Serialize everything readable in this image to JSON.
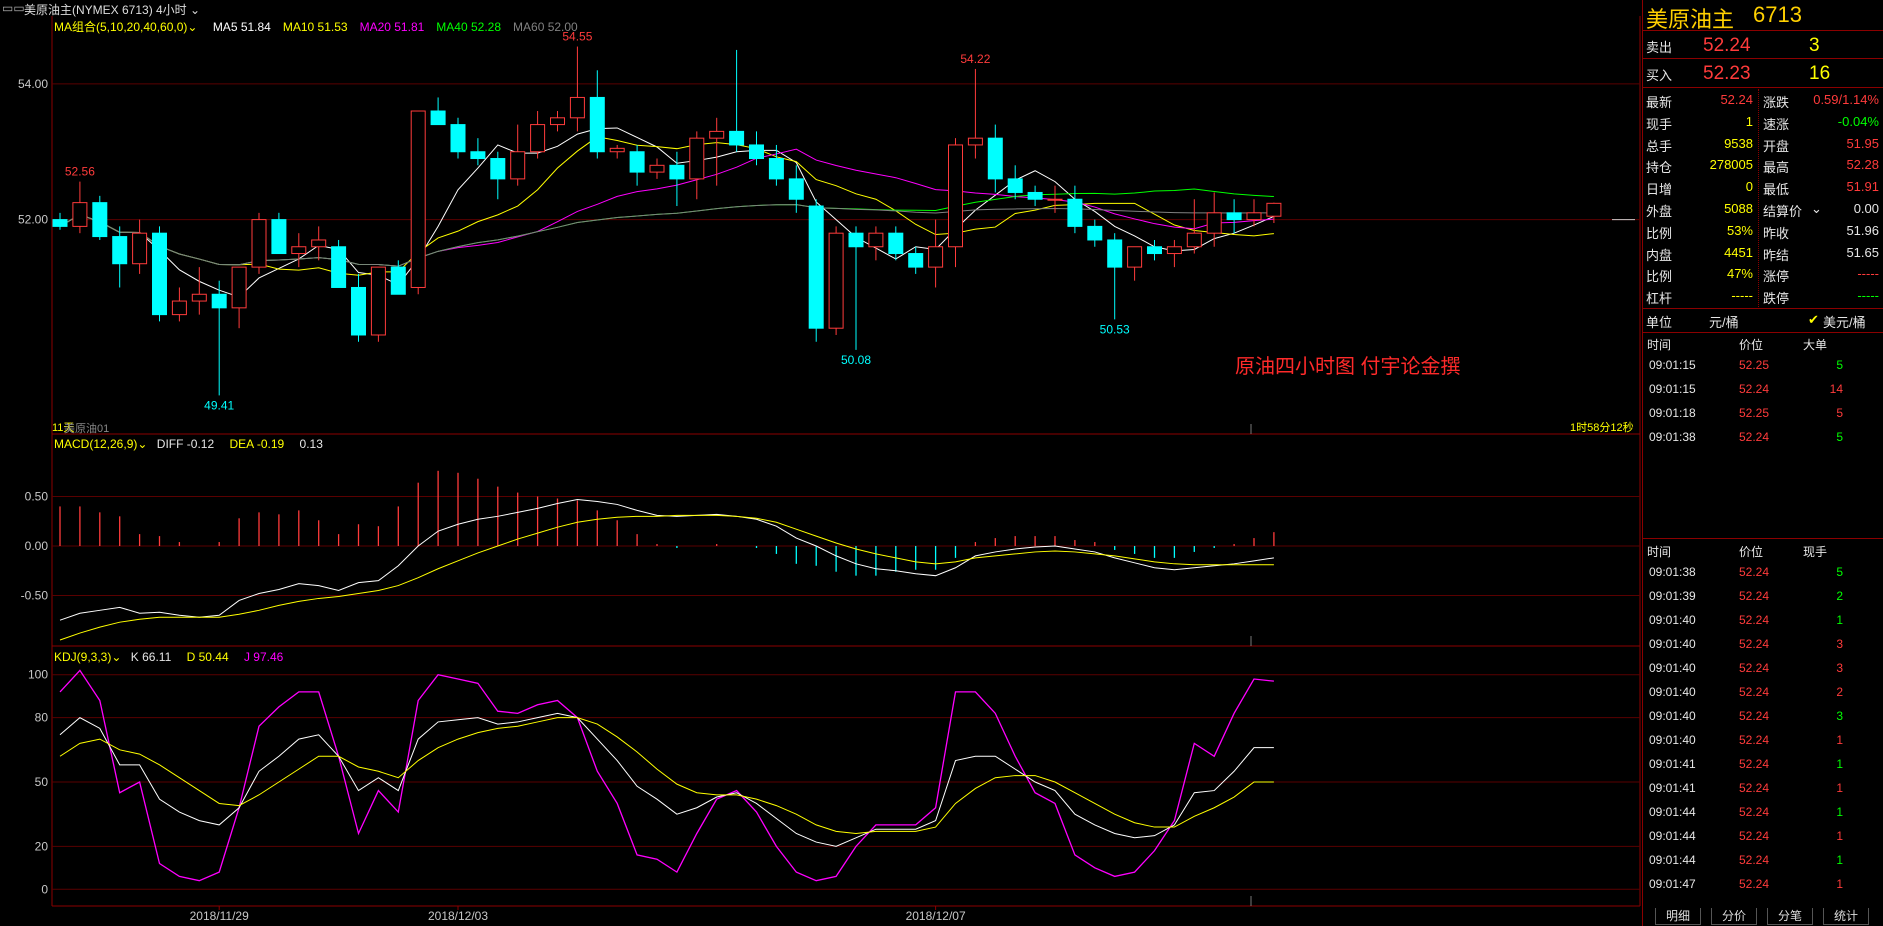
{
  "title_bar": {
    "symbol": "美原油主(NYMEX 6713)",
    "period": "4小时"
  },
  "chart_data": [
    {
      "type": "candlestick",
      "title": "MA组合(5,10,20,40,60,0)",
      "ma_labels": [
        {
          "name": "MA5",
          "value": "51.84",
          "color": "#ffffff"
        },
        {
          "name": "MA10",
          "value": "51.53",
          "color": "#ffff00"
        },
        {
          "name": "MA20",
          "value": "51.81",
          "color": "#ff00ff"
        },
        {
          "name": "MA40",
          "value": "52.28",
          "color": "#00ff00"
        },
        {
          "name": "MA60",
          "value": "52.00",
          "color": "#808080"
        }
      ],
      "ylim": [
        48.9,
        55.0
      ],
      "y_ticks": [
        "54.00",
        "52.00"
      ],
      "x_ticks": [
        {
          "label": "2018/11/29",
          "index": 8
        },
        {
          "label": "2018/12/03",
          "index": 20
        },
        {
          "label": "2018/12/07",
          "index": 44
        }
      ],
      "annotations": [
        {
          "text": "52.56",
          "index": 1,
          "price": 52.56,
          "color": "#ff3b3b",
          "pos": "above"
        },
        {
          "text": "49.41",
          "index": 8,
          "price": 49.41,
          "color": "#00ffff",
          "pos": "below"
        },
        {
          "text": "54.55",
          "index": 26,
          "price": 54.55,
          "color": "#ff3b3b",
          "pos": "above"
        },
        {
          "text": "54.22",
          "index": 46,
          "price": 54.22,
          "color": "#ff3b3b",
          "pos": "above"
        },
        {
          "text": "50.08",
          "index": 40,
          "price": 50.08,
          "color": "#00ffff",
          "pos": "below"
        },
        {
          "text": "50.53",
          "index": 53,
          "price": 50.53,
          "color": "#00ffff",
          "pos": "below"
        }
      ],
      "candles": [
        [
          52.0,
          52.1,
          51.85,
          51.9
        ],
        [
          51.9,
          52.56,
          51.8,
          52.25
        ],
        [
          52.25,
          52.35,
          51.7,
          51.75
        ],
        [
          51.75,
          51.9,
          51.0,
          51.35
        ],
        [
          51.35,
          52.0,
          51.2,
          51.8
        ],
        [
          51.8,
          51.9,
          50.5,
          50.6
        ],
        [
          50.6,
          51.0,
          50.5,
          50.8
        ],
        [
          50.8,
          51.3,
          50.6,
          50.9
        ],
        [
          50.9,
          51.1,
          49.41,
          50.7
        ],
        [
          50.7,
          51.3,
          50.4,
          51.3
        ],
        [
          51.3,
          52.1,
          51.2,
          52.0
        ],
        [
          52.0,
          52.1,
          51.5,
          51.5
        ],
        [
          51.5,
          51.8,
          51.3,
          51.6
        ],
        [
          51.6,
          51.9,
          51.4,
          51.7
        ],
        [
          51.6,
          51.7,
          51.0,
          51.0
        ],
        [
          51.0,
          51.2,
          50.2,
          50.3
        ],
        [
          50.3,
          51.3,
          50.2,
          51.3
        ],
        [
          51.3,
          51.4,
          50.9,
          50.9
        ],
        [
          51.0,
          53.6,
          50.9,
          53.6
        ],
        [
          53.6,
          53.8,
          53.4,
          53.4
        ],
        [
          53.4,
          53.5,
          52.9,
          53.0
        ],
        [
          53.0,
          53.2,
          52.8,
          52.9
        ],
        [
          52.9,
          53.0,
          52.3,
          52.6
        ],
        [
          52.6,
          53.4,
          52.5,
          53.0
        ],
        [
          53.0,
          53.6,
          52.9,
          53.4
        ],
        [
          53.4,
          53.6,
          53.3,
          53.5
        ],
        [
          53.5,
          54.55,
          53.3,
          53.8
        ],
        [
          53.8,
          54.2,
          52.9,
          53.0
        ],
        [
          53.0,
          53.1,
          52.9,
          53.05
        ],
        [
          53.0,
          53.1,
          52.5,
          52.7
        ],
        [
          52.7,
          52.9,
          52.6,
          52.8
        ],
        [
          52.8,
          53.0,
          52.2,
          52.6
        ],
        [
          52.6,
          53.3,
          52.3,
          53.2
        ],
        [
          53.2,
          53.5,
          52.5,
          53.3
        ],
        [
          53.3,
          54.5,
          53.0,
          53.1
        ],
        [
          53.1,
          53.3,
          52.8,
          52.9
        ],
        [
          52.9,
          53.1,
          52.5,
          52.6
        ],
        [
          52.6,
          52.8,
          52.1,
          52.3
        ],
        [
          52.2,
          52.3,
          50.2,
          50.4
        ],
        [
          50.4,
          51.9,
          50.3,
          51.8
        ],
        [
          51.8,
          51.9,
          50.08,
          51.6
        ],
        [
          51.6,
          51.9,
          51.4,
          51.8
        ],
        [
          51.8,
          51.9,
          51.4,
          51.5
        ],
        [
          51.5,
          51.6,
          51.2,
          51.3
        ],
        [
          51.3,
          52.0,
          51.0,
          51.6
        ],
        [
          51.6,
          53.2,
          51.3,
          53.1
        ],
        [
          53.1,
          54.22,
          52.9,
          53.2
        ],
        [
          53.2,
          53.4,
          52.4,
          52.6
        ],
        [
          52.6,
          52.8,
          52.3,
          52.4
        ],
        [
          52.4,
          52.5,
          52.2,
          52.3
        ],
        [
          52.3,
          52.5,
          52.1,
          52.3
        ],
        [
          52.3,
          52.5,
          51.8,
          51.9
        ],
        [
          51.9,
          52.0,
          51.6,
          51.7
        ],
        [
          51.7,
          51.8,
          50.53,
          51.3
        ],
        [
          51.3,
          51.6,
          51.1,
          51.6
        ],
        [
          51.6,
          51.7,
          51.4,
          51.5
        ],
        [
          51.5,
          51.7,
          51.3,
          51.6
        ],
        [
          51.6,
          52.3,
          51.5,
          51.8
        ],
        [
          51.8,
          52.4,
          51.6,
          52.1
        ],
        [
          52.1,
          52.3,
          51.8,
          52.0
        ],
        [
          52.0,
          52.3,
          51.9,
          52.1
        ],
        [
          52.05,
          52.25,
          51.95,
          52.24
        ]
      ],
      "watermark": "原油四小时图  付宇论金撰",
      "bottom_left_label": "11天",
      "bottom_left_label2": "美原油01",
      "countdown": "1时58分12秒"
    },
    {
      "type": "macd",
      "title": "MACD(12,26,9)",
      "diff_label": "DIFF -0.12",
      "dea_label": "DEA -0.19",
      "macd_label": "0.13",
      "ylim": [
        -0.95,
        0.95
      ],
      "y_ticks": [
        "0.50",
        "0.00",
        "-0.50"
      ],
      "diff": [
        -0.75,
        -0.68,
        -0.65,
        -0.62,
        -0.68,
        -0.67,
        -0.7,
        -0.72,
        -0.7,
        -0.55,
        -0.48,
        -0.44,
        -0.38,
        -0.4,
        -0.45,
        -0.37,
        -0.35,
        -0.2,
        0.0,
        0.15,
        0.22,
        0.27,
        0.3,
        0.34,
        0.38,
        0.43,
        0.47,
        0.45,
        0.42,
        0.36,
        0.31,
        0.3,
        0.31,
        0.32,
        0.3,
        0.27,
        0.2,
        0.08,
        0.0,
        -0.1,
        -0.18,
        -0.23,
        -0.25,
        -0.28,
        -0.3,
        -0.22,
        -0.1,
        -0.06,
        -0.03,
        -0.01,
        0.0,
        -0.03,
        -0.06,
        -0.12,
        -0.17,
        -0.22,
        -0.24,
        -0.22,
        -0.2,
        -0.18,
        -0.15,
        -0.12
      ],
      "dea": [
        -0.95,
        -0.88,
        -0.82,
        -0.77,
        -0.74,
        -0.72,
        -0.72,
        -0.72,
        -0.72,
        -0.69,
        -0.65,
        -0.6,
        -0.56,
        -0.53,
        -0.51,
        -0.48,
        -0.45,
        -0.4,
        -0.32,
        -0.23,
        -0.15,
        -0.07,
        0.0,
        0.07,
        0.13,
        0.19,
        0.24,
        0.27,
        0.29,
        0.3,
        0.3,
        0.31,
        0.31,
        0.31,
        0.3,
        0.28,
        0.24,
        0.17,
        0.1,
        0.03,
        -0.03,
        -0.08,
        -0.12,
        -0.16,
        -0.18,
        -0.16,
        -0.12,
        -0.1,
        -0.08,
        -0.06,
        -0.05,
        -0.06,
        -0.08,
        -0.1,
        -0.13,
        -0.16,
        -0.18,
        -0.19,
        -0.19,
        -0.19,
        -0.19,
        -0.19
      ]
    },
    {
      "type": "kdj",
      "title": "KDJ(9,3,3)",
      "k_label": "K 66.11",
      "d_label": "D 50.44",
      "j_label": "J 97.46",
      "ylim": [
        -5,
        105
      ],
      "y_ticks": [
        "100",
        "80",
        "50",
        "20",
        "0"
      ],
      "k": [
        72,
        80,
        75,
        58,
        58,
        42,
        36,
        32,
        30,
        38,
        55,
        62,
        70,
        72,
        62,
        46,
        52,
        46,
        70,
        78,
        79,
        80,
        77,
        78,
        80,
        82,
        80,
        70,
        60,
        48,
        42,
        35,
        38,
        43,
        45,
        40,
        33,
        26,
        22,
        20,
        24,
        28,
        28,
        28,
        32,
        60,
        62,
        62,
        56,
        50,
        46,
        35,
        30,
        26,
        24,
        25,
        30,
        45,
        46,
        55,
        66,
        66
      ],
      "d": [
        62,
        68,
        70,
        65,
        63,
        58,
        52,
        46,
        40,
        39,
        44,
        50,
        56,
        62,
        62,
        57,
        55,
        52,
        60,
        66,
        70,
        73,
        75,
        76,
        78,
        80,
        80,
        77,
        71,
        64,
        56,
        49,
        45,
        44,
        44,
        42,
        39,
        35,
        30,
        27,
        26,
        27,
        27,
        27,
        29,
        40,
        47,
        52,
        53,
        53,
        50,
        45,
        40,
        35,
        31,
        29,
        29,
        34,
        38,
        43,
        50,
        50
      ],
      "j": [
        92,
        102,
        88,
        45,
        50,
        12,
        6,
        4,
        8,
        38,
        76,
        85,
        92,
        92,
        62,
        26,
        46,
        36,
        88,
        100,
        98,
        96,
        83,
        82,
        86,
        88,
        80,
        55,
        40,
        16,
        14,
        8,
        26,
        42,
        46,
        36,
        20,
        8,
        4,
        6,
        20,
        30,
        30,
        30,
        38,
        92,
        92,
        82,
        62,
        45,
        40,
        16,
        10,
        6,
        8,
        18,
        32,
        68,
        62,
        82,
        98,
        97
      ]
    }
  ],
  "right_panel": {
    "title": "美原油主",
    "code": "6713",
    "ask": {
      "label": "卖出",
      "price": "52.24",
      "vol": "3"
    },
    "bid": {
      "label": "买入",
      "price": "52.23",
      "vol": "16"
    },
    "stats_left": [
      {
        "label": "最新",
        "value": "52.24",
        "color": "red"
      },
      {
        "label": "现手",
        "value": "1",
        "color": "yel"
      },
      {
        "label": "总手",
        "value": "9538",
        "color": "yel"
      },
      {
        "label": "持仓",
        "value": "278005",
        "color": "yel"
      },
      {
        "label": "日增",
        "value": "0",
        "color": "yel"
      },
      {
        "label": "外盘",
        "value": "5088",
        "color": "yel"
      },
      {
        "label": "比例",
        "value": "53%",
        "color": "yel"
      },
      {
        "label": "内盘",
        "value": "4451",
        "color": "yel"
      },
      {
        "label": "比例",
        "value": "47%",
        "color": "yel"
      },
      {
        "label": "杠杆",
        "value": "-----",
        "color": "yel"
      }
    ],
    "stats_right": [
      {
        "label": "涨跌",
        "value": "0.59/1.14%",
        "color": "red"
      },
      {
        "label": "速涨",
        "value": "-0.04%",
        "color": "grn"
      },
      {
        "label": "开盘",
        "value": "51.95",
        "color": "red"
      },
      {
        "label": "最高",
        "value": "52.28",
        "color": "red"
      },
      {
        "label": "最低",
        "value": "51.91",
        "color": "red"
      },
      {
        "label": "结算价",
        "value": "0.00",
        "color": "wht"
      },
      {
        "label": "昨收",
        "value": "51.96",
        "color": "wht"
      },
      {
        "label": "昨结",
        "value": "51.65",
        "color": "wht"
      },
      {
        "label": "涨停",
        "value": "-----",
        "color": "red"
      },
      {
        "label": "跌停",
        "value": "-----",
        "color": "grn"
      }
    ],
    "unit": {
      "label": "单位",
      "opt1": "元/桶",
      "opt2": "美元/桶"
    },
    "big_orders": {
      "headers": [
        "时间",
        "价位",
        "大单"
      ],
      "rows": [
        {
          "t": "09:01:15",
          "p": "52.25",
          "v": "5",
          "vc": "grn"
        },
        {
          "t": "09:01:15",
          "p": "52.24",
          "v": "14",
          "vc": "red"
        },
        {
          "t": "09:01:18",
          "p": "52.25",
          "v": "5",
          "vc": "red"
        },
        {
          "t": "09:01:38",
          "p": "52.24",
          "v": "5",
          "vc": "grn"
        }
      ]
    },
    "ticks": {
      "headers": [
        "时间",
        "价位",
        "现手"
      ],
      "rows": [
        {
          "t": "09:01:38",
          "p": "52.24",
          "v": "5",
          "vc": "grn"
        },
        {
          "t": "09:01:39",
          "p": "52.24",
          "v": "2",
          "vc": "grn"
        },
        {
          "t": "09:01:40",
          "p": "52.24",
          "v": "1",
          "vc": "grn"
        },
        {
          "t": "09:01:40",
          "p": "52.24",
          "v": "3",
          "vc": "red"
        },
        {
          "t": "09:01:40",
          "p": "52.24",
          "v": "3",
          "vc": "red"
        },
        {
          "t": "09:01:40",
          "p": "52.24",
          "v": "2",
          "vc": "red"
        },
        {
          "t": "09:01:40",
          "p": "52.24",
          "v": "3",
          "vc": "grn"
        },
        {
          "t": "09:01:40",
          "p": "52.24",
          "v": "1",
          "vc": "red"
        },
        {
          "t": "09:01:41",
          "p": "52.24",
          "v": "1",
          "vc": "grn"
        },
        {
          "t": "09:01:41",
          "p": "52.24",
          "v": "1",
          "vc": "red"
        },
        {
          "t": "09:01:44",
          "p": "52.24",
          "v": "1",
          "vc": "grn"
        },
        {
          "t": "09:01:44",
          "p": "52.24",
          "v": "1",
          "vc": "red"
        },
        {
          "t": "09:01:44",
          "p": "52.24",
          "v": "1",
          "vc": "grn"
        },
        {
          "t": "09:01:47",
          "p": "52.24",
          "v": "1",
          "vc": "red"
        }
      ]
    },
    "tabs": [
      "明细",
      "分价",
      "分笔",
      "统计"
    ]
  },
  "colors": {
    "up": "#ff3b3b",
    "down": "#00ffff",
    "border": "#8b0000",
    "grid": "#5a0000"
  }
}
